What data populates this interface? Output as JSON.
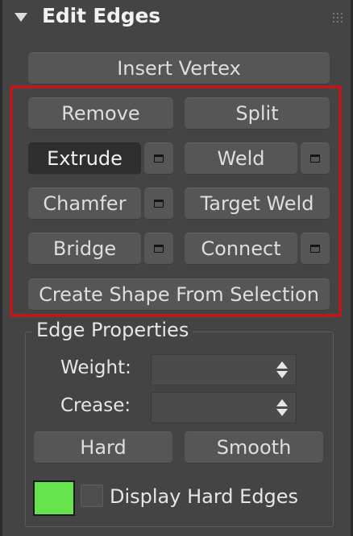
{
  "rollout": {
    "title": "Edit Edges",
    "expand_icon": "triangle-down-icon",
    "grip_icon": "drag-grip-icon"
  },
  "buttons": {
    "insert_vertex": "Insert Vertex",
    "remove": "Remove",
    "split": "Split",
    "extrude": "Extrude",
    "weld": "Weld",
    "chamfer": "Chamfer",
    "target_weld": "Target Weld",
    "bridge": "Bridge",
    "connect": "Connect",
    "create_shape": "Create Shape From Selection",
    "settings_icon": "settings-box-icon"
  },
  "edge_properties": {
    "title": "Edge Properties",
    "weight_label": "Weight:",
    "weight_value": "",
    "crease_label": "Crease:",
    "crease_value": "",
    "hard_label": "Hard",
    "smooth_label": "Smooth",
    "display_hard_edges_label": "Display Hard Edges",
    "display_hard_edges_checked": false,
    "hard_edge_color": "#66e34d"
  },
  "colors": {
    "panel_bg": "#444444",
    "button_bg": "#565656",
    "active_button_bg": "#2e2e2e",
    "highlight_border": "#b51d1d"
  }
}
